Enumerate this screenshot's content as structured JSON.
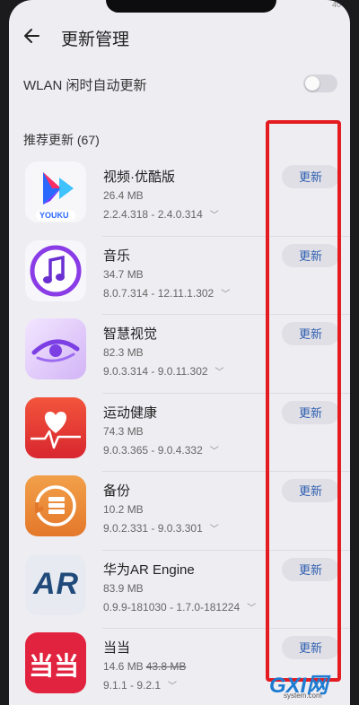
{
  "status": {
    "right": "40"
  },
  "header": {
    "title": "更新管理"
  },
  "wlan": {
    "label": "WLAN 闲时自动更新",
    "enabled": false
  },
  "section": {
    "title": "推荐更新 (67)"
  },
  "items": [
    {
      "name": "视频·优酷版",
      "size": "26.4 MB",
      "version": "2.2.4.318 - 2.4.0.314",
      "button": "更新",
      "icon_text": "YOUKU",
      "icon": "youku-icon"
    },
    {
      "name": "音乐",
      "size": "34.7 MB",
      "version": "8.0.7.314 - 12.11.1.302",
      "button": "更新",
      "icon": "music-icon"
    },
    {
      "name": "智慧视觉",
      "size": "82.3 MB",
      "version": "9.0.3.314 - 9.0.11.302",
      "button": "更新",
      "icon": "vision-icon"
    },
    {
      "name": "运动健康",
      "size": "74.3 MB",
      "version": "9.0.3.365 - 9.0.4.332",
      "button": "更新",
      "icon": "health-icon"
    },
    {
      "name": "备份",
      "size": "10.2 MB",
      "version": "9.0.2.331 - 9.0.3.301",
      "button": "更新",
      "icon": "backup-icon"
    },
    {
      "name": "华为AR Engine",
      "size": "83.9 MB",
      "version": "0.9.9-181030 - 1.7.0-181224",
      "button": "更新",
      "icon_text": "AR",
      "icon": "ar-engine-icon"
    },
    {
      "name": "当当",
      "size": "14.6 MB",
      "old_size": "43.8 MB",
      "version": "9.1.1 - 9.2.1",
      "button": "更新",
      "icon_text": "当当",
      "icon": "dangdang-icon"
    }
  ],
  "watermark": {
    "big": "GXI网",
    "small": "system.com"
  },
  "colors": {
    "highlight": "#e41b20",
    "button_text": "#2f5fb0"
  }
}
